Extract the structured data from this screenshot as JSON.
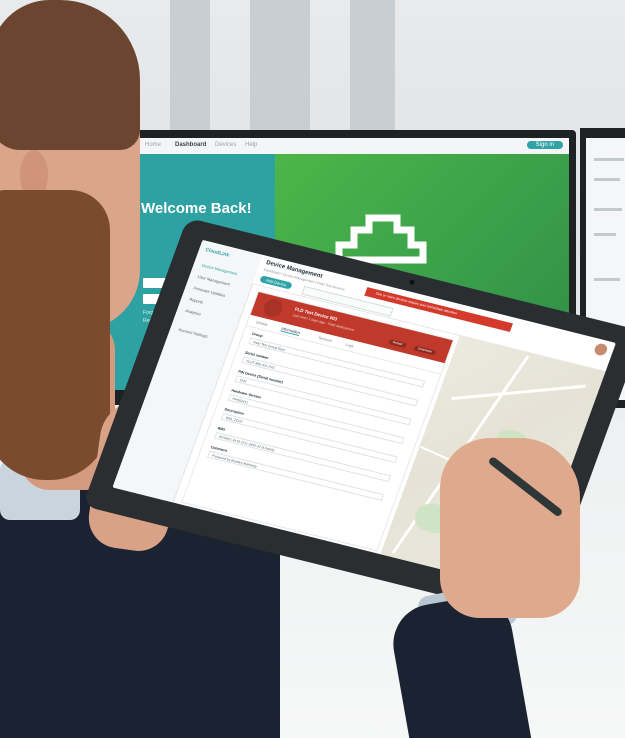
{
  "monitor": {
    "tabs": [
      "Home",
      "Dashboard",
      "Devices",
      "Help"
    ],
    "sign_in": "Sign in",
    "welcome": "Welcome Back!",
    "field_user": "Email",
    "field_pass": "Password",
    "forgot": "Forgot Password",
    "remember": "Remember me",
    "brand_colors": {
      "teal": "#2ea1a3",
      "green": "#3fae49"
    }
  },
  "tablet_app": {
    "logo": "CloudLink",
    "title": "Device Management",
    "breadcrumb": "Dashboard / Device Management / Field Test Devices",
    "alert": "One or more devices require your immediate attention",
    "add_button": "Add Device",
    "sidebar": [
      "Device Management",
      "User Management",
      "Firmware Updates",
      "Reports",
      "Analytics",
      "Account Settings"
    ],
    "card": {
      "name": "FLD Test Device 003",
      "status": "Offline",
      "subtitle": "Last seen 2 days ago · Field deployment",
      "pills": [
        "Restart",
        "Deactivate"
      ],
      "tabs": [
        "Details",
        "Information",
        "Sensors",
        "Logs"
      ],
      "fields": [
        {
          "label": "Group",
          "value": "Field Test Group East"
        },
        {
          "label": "Serial number",
          "value": "FLDT-983-421-P42"
        },
        {
          "label": "PIN Device (Serial number)",
          "value": "1241"
        },
        {
          "label": "Hardware Version",
          "value": "HP002411"
        },
        {
          "label": "Description",
          "value": "WID_ZCD2"
        },
        {
          "label": "IMEI",
          "value": "3579421 3419 2211 0491 42 B Family"
        },
        {
          "label": "Comment",
          "value": "Produced by Bradley Mahoney"
        }
      ]
    },
    "accent": "#2fa3a6",
    "alert_color": "#d33a2c"
  }
}
